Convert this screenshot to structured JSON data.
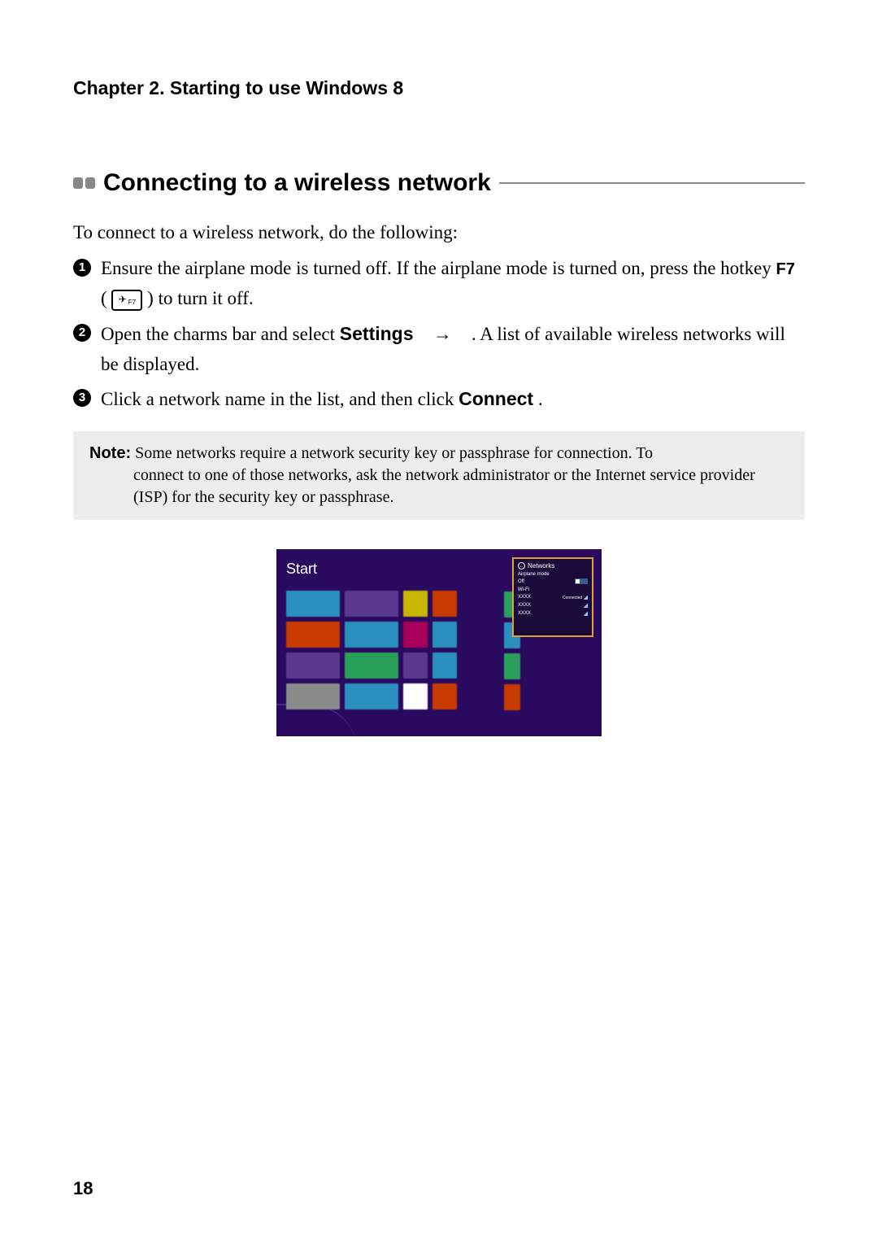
{
  "chapter_header": "Chapter 2. Starting to use Windows 8",
  "section_title": "Connecting to a wireless network",
  "intro": "To connect to a wireless network, do the following:",
  "steps": {
    "s1_a": "Ensure the airplane mode is turned off. If the airplane mode is turned on, press the hotkey ",
    "s1_hotkey": "F7",
    "s1_keyfn": "F7",
    "s1_b": " (",
    "s1_c": ") to turn it off.",
    "s2_a": "Open the charms bar and select ",
    "s2_settings": "Settings",
    "s2_arrow": "→",
    "s2_b": " . A list of available wireless networks will be displayed.",
    "s3_a": "Click a network name in the list, and then click ",
    "s3_connect": "Connect",
    "s3_b": "."
  },
  "note": {
    "label": "Note:",
    "first_line": " Some networks require a network security key or passphrase for connection. To",
    "rest": "connect to one of those networks, ask the network administrator or the Internet service provider (ISP) for the security key or passphrase."
  },
  "figure": {
    "start_label": "Start",
    "tiles": {
      "r1": [
        {
          "color": "#2a8fbf",
          "w": "tw"
        },
        {
          "color": "#5a3a8f",
          "w": "tw"
        },
        {
          "color": "#c7b500",
          "w": "ts"
        },
        {
          "color": "#c73a00",
          "w": "ts"
        }
      ],
      "r2": [
        {
          "color": "#c73a00",
          "w": "tw"
        },
        {
          "color": "#2a8fbf",
          "w": "tw"
        },
        {
          "color": "#a8005a",
          "w": "ts"
        },
        {
          "color": "#2a8fbf",
          "w": "ts"
        }
      ],
      "r3": [
        {
          "color": "#5a3a8f",
          "w": "tw"
        },
        {
          "color": "#2a9f5a",
          "w": "tw"
        },
        {
          "color": "#5a3a8f",
          "w": "ts"
        },
        {
          "color": "#2a8fbf",
          "w": "ts"
        }
      ],
      "r4": [
        {
          "color": "#8a8a8a",
          "w": "tw"
        },
        {
          "color": "#2a8fbf",
          "w": "tw"
        },
        {
          "color": "#ffffff",
          "w": "ts"
        },
        {
          "color": "#c73a00",
          "w": "ts"
        }
      ],
      "side": [
        {
          "color": "#2a9f5a"
        },
        {
          "color": "#2a8fbf"
        },
        {
          "color": "#2a9f5a"
        },
        {
          "color": "#c73a00"
        }
      ]
    },
    "networks_panel": {
      "title": "Networks",
      "airplane_label": "Airplane mode",
      "airplane_state": "Off",
      "wifi_label": "Wi-Fi",
      "items": [
        {
          "name": "XXXX",
          "status": "Connected"
        },
        {
          "name": "XXXX",
          "status": ""
        },
        {
          "name": "XXXX",
          "status": ""
        }
      ]
    }
  },
  "page_number": "18"
}
